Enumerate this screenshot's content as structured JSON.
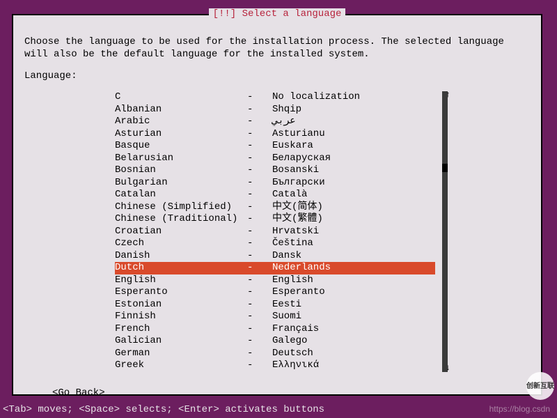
{
  "title": "[!!] Select a language",
  "instructions": "Choose the language to be used for the installation process. The selected language will also be the default language for the installed system.",
  "label": "Language:",
  "selected_index": 14,
  "languages": [
    {
      "name": "C",
      "native": "No localization"
    },
    {
      "name": "Albanian",
      "native": "Shqip"
    },
    {
      "name": "Arabic",
      "native": "عربي"
    },
    {
      "name": "Asturian",
      "native": "Asturianu"
    },
    {
      "name": "Basque",
      "native": "Euskara"
    },
    {
      "name": "Belarusian",
      "native": "Беларуская"
    },
    {
      "name": "Bosnian",
      "native": "Bosanski"
    },
    {
      "name": "Bulgarian",
      "native": "Български"
    },
    {
      "name": "Catalan",
      "native": "Català"
    },
    {
      "name": "Chinese (Simplified)",
      "native": "中文(简体)"
    },
    {
      "name": "Chinese (Traditional)",
      "native": "中文(繁體)"
    },
    {
      "name": "Croatian",
      "native": "Hrvatski"
    },
    {
      "name": "Czech",
      "native": "Čeština"
    },
    {
      "name": "Danish",
      "native": "Dansk"
    },
    {
      "name": "Dutch",
      "native": "Nederlands"
    },
    {
      "name": "English",
      "native": "English"
    },
    {
      "name": "Esperanto",
      "native": "Esperanto"
    },
    {
      "name": "Estonian",
      "native": "Eesti"
    },
    {
      "name": "Finnish",
      "native": "Suomi"
    },
    {
      "name": "French",
      "native": "Français"
    },
    {
      "name": "Galician",
      "native": "Galego"
    },
    {
      "name": "German",
      "native": "Deutsch"
    },
    {
      "name": "Greek",
      "native": "Ελληνικά"
    }
  ],
  "goback": "<Go Back>",
  "statusbar": "<Tab> moves; <Space> selects; <Enter> activates buttons",
  "watermark": "https://blog.csdn",
  "logo": "创新互联",
  "scroll_arrow_up": "↑",
  "scroll_arrow_down": "↓"
}
